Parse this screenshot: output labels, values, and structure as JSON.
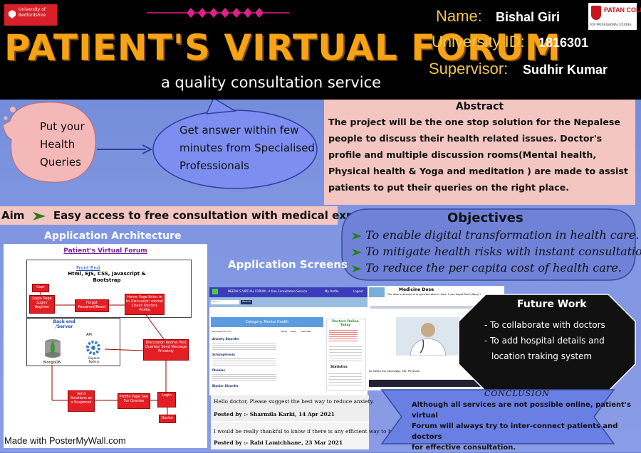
{
  "header": {
    "university_logo_text": "University of Bedfordshire",
    "title": "PATIENT'S VIRTUAL FORUM",
    "subtitle": "a quality consultation service",
    "name_label": "Name:",
    "name_value": "Bishal Giri",
    "id_label": "University ID:",
    "id_value": "1816301",
    "supervisor_label": "Supervisor:",
    "supervisor_value": "Sudhir Kumar",
    "college_logo_text": "PATAN COLLEGE",
    "college_logo_sub": "FOR PROFESSIONAL STUDIES"
  },
  "bubbles": {
    "queries": [
      "Put your",
      "Health",
      "Queries"
    ],
    "answer": [
      "Get answer within few",
      "minutes from Specialised",
      "Professionals"
    ]
  },
  "abstract": {
    "heading": "Abstract",
    "text": "The project will be the one stop solution for the Nepalese people to discuss their health related issues. Doctor's profile and multiple discussion rooms(Mental health, Physical health & Yoga and meditation ) are made to assist patients to put their queries on the right place."
  },
  "aim": {
    "label": "Aim",
    "text": "Easy access to free consultation with medical experts."
  },
  "architecture": {
    "heading": "Application Architecture",
    "diagram_title": "Patient's Virtual Forum",
    "frontend_title": "Front End",
    "frontend_tech": "Html, EJS, CSS, Javascript & Bootstrap",
    "backend_title": "Back end /Server",
    "api_label": "API",
    "express_label": "Express Node.js",
    "db_label": "MongoDB",
    "boxes": {
      "user": "User",
      "login_register": "Login Page Login/ Register",
      "forgot": "Forgot Password/Reset",
      "home": "Home Page Enter in to Discussion rooms/ Check Doctors Profile",
      "discussion": "Discussion Rooms Post Queries/ Send Message Privately",
      "send_solutions": "Send Solutions as a Response",
      "profile": "Profile Page See For Queries",
      "login": "Login",
      "doctor": "Doctor"
    }
  },
  "screens": {
    "heading": "Application Screens",
    "screen1": {
      "brand": "NEEPAL'S VIRTUAL FORUM - A free Consultation Service",
      "nav_profile": "My Profile",
      "nav_logout": "Logout",
      "search_placeholder": "Search",
      "search_button": "Search",
      "category_heading": "Category: Mental Health",
      "columns": [
        "Discussion Forum",
        "Topics",
        "Posts",
        "Last Posts"
      ],
      "topics": [
        "Anxiety Disorder",
        "Schizophrenia",
        "Phobias",
        "Bipolar Disorder"
      ],
      "doctors_heading": "Doctors Online Today",
      "stats_heading": "Statistics"
    },
    "screen2": {
      "title": "Medicine Dose",
      "subtitle": "The dose is amount of drug to be taken in time. If you forget Don't Worry!!",
      "caption": "Dr. Neetu Jha, Neurology, MD, Physician"
    },
    "posts": [
      {
        "text": "Hello doctor, Please suggest the best way to reduce anxiety.",
        "meta": "Posted by :- Sharmila Karki, 14 Apr 2021"
      },
      {
        "text": "I would be really thankful to know if there is any efficient way to boost our mind.",
        "meta": "Posted by :- Rabi Lamichhane, 23 Mar 2021"
      }
    ]
  },
  "objectives": {
    "heading": "Objectives",
    "items": [
      "To enable digital transformation in health care.",
      "To mitigate health risks with instant consultation.",
      "To reduce the per capita cost of health care."
    ]
  },
  "future_work": {
    "heading": "Future Work",
    "items": [
      "- To collaborate with doctors",
      "- To  add hospital details and",
      "location traking system"
    ]
  },
  "conclusion": {
    "heading": "CONCLUSION",
    "text_lines": [
      "Although all services are not possible online, patient's virtual",
      "Forum will always try to  inter-connect patients and doctors",
      "for effective consultation."
    ]
  },
  "footer": "Made with PosterMyWall.com",
  "colors": {
    "background": "#7f95e0",
    "header": "#000000",
    "title_orange": "#f6a316",
    "label_gold": "#f2c64a",
    "pink_panel": "#f4c6c2",
    "bubble_blue": "#7d8ef0",
    "bubble_pink": "#f4b8b8",
    "objective_panel": "#6f82d8",
    "dark_octagon": "#111111",
    "arrow_green": "#2c7a1a"
  }
}
